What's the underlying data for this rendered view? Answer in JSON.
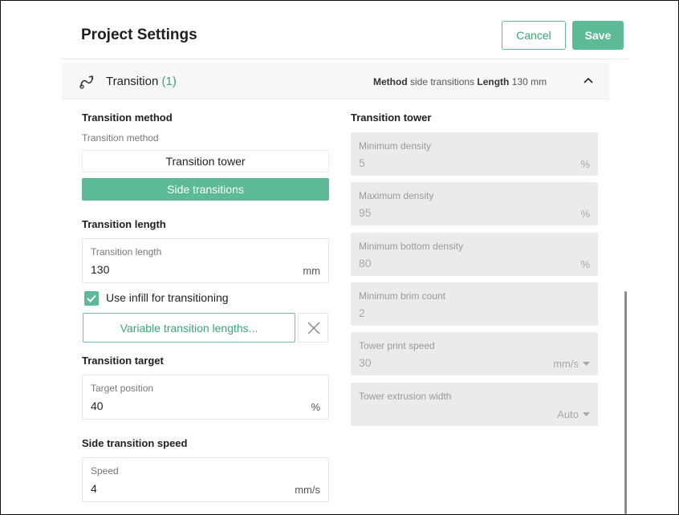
{
  "header": {
    "title": "Project Settings",
    "cancel_label": "Cancel",
    "save_label": "Save"
  },
  "section": {
    "title": "Transition",
    "count": "(1)",
    "summary_method_key": "Method",
    "summary_method_value": "side transitions",
    "summary_length_key": "Length",
    "summary_length_value": "130 mm"
  },
  "left": {
    "method_heading": "Transition method",
    "method_sublabel": "Transition method",
    "method_options": [
      "Transition tower",
      "Side transitions"
    ],
    "method_selected": "Side transitions",
    "length_heading": "Transition length",
    "length_field": {
      "label": "Transition length",
      "value": "130",
      "unit": "mm"
    },
    "infill_checkbox": {
      "label": "Use infill for transitioning",
      "checked": true
    },
    "variable_button": "Variable transition lengths...",
    "target_heading": "Transition target",
    "target_field": {
      "label": "Target position",
      "value": "40",
      "unit": "%"
    },
    "speed_heading": "Side transition speed",
    "speed_field": {
      "label": "Speed",
      "value": "4",
      "unit": "mm/s"
    }
  },
  "right": {
    "heading": "Transition tower",
    "fields": [
      {
        "label": "Minimum density",
        "value": "5",
        "unit": "%"
      },
      {
        "label": "Maximum density",
        "value": "95",
        "unit": "%"
      },
      {
        "label": "Minimum bottom density",
        "value": "80",
        "unit": "%"
      },
      {
        "label": "Minimum brim count",
        "value": "2",
        "unit": ""
      },
      {
        "label": "Tower print speed",
        "value": "30",
        "unit": "mm/s"
      },
      {
        "label": "Tower extrusion width",
        "value": "",
        "unit": "Auto"
      }
    ]
  },
  "colors": {
    "accent": "#5cba96",
    "accent_text": "#3aa679",
    "disabled_bg": "#ebebeb"
  },
  "icons": [
    "transition-icon",
    "chevron-up-icon",
    "check-icon",
    "close-icon",
    "dropdown-caret-icon"
  ]
}
